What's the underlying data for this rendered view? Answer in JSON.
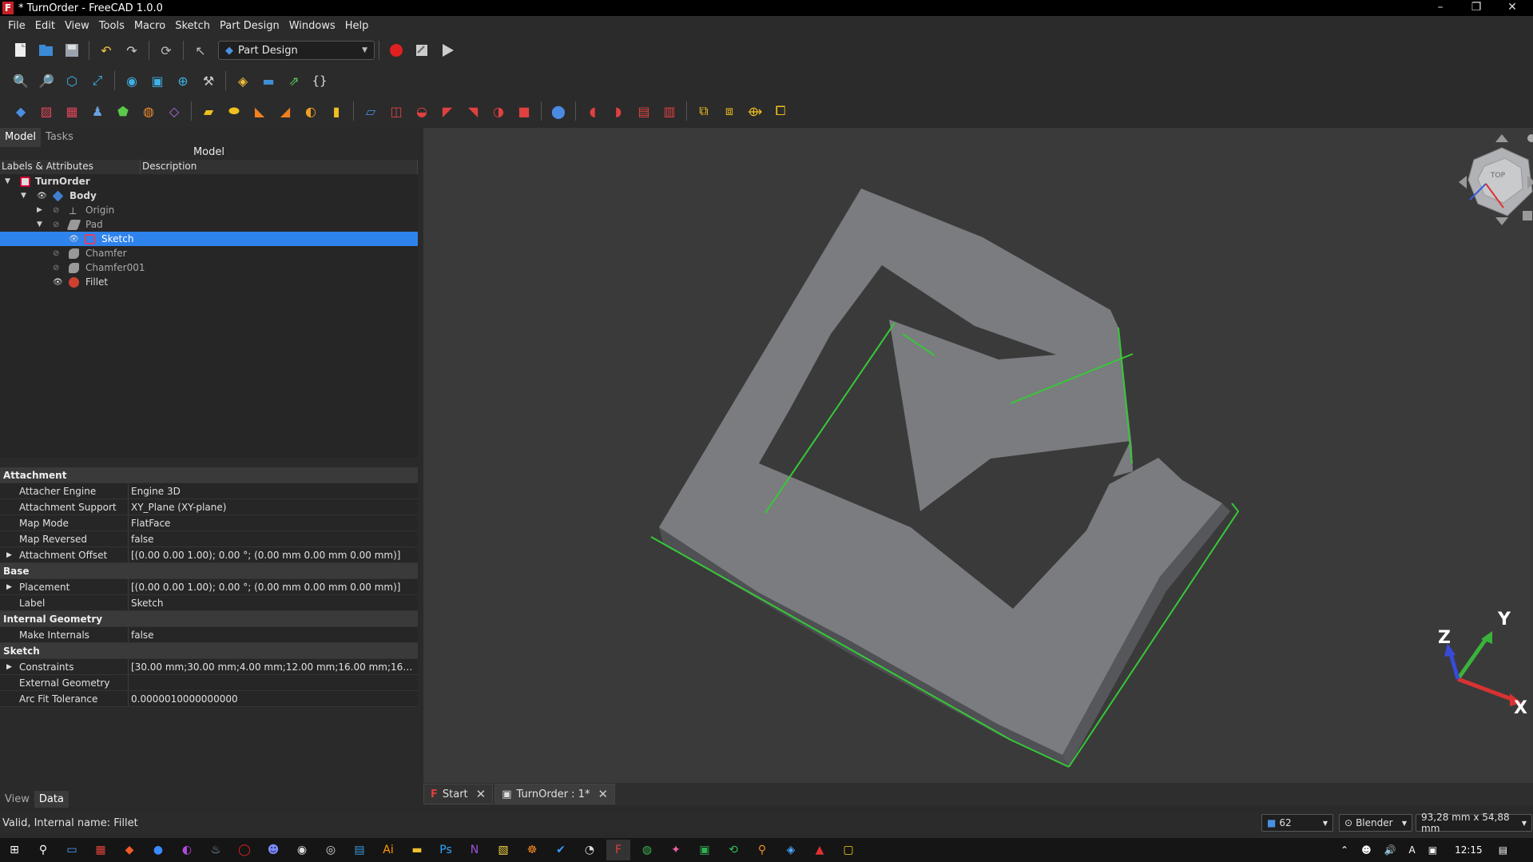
{
  "window": {
    "title": "* TurnOrder - FreeCAD 1.0.0",
    "app_icon": "F"
  },
  "window_controls": {
    "minimize": "–",
    "restore": "❐",
    "close": "✕"
  },
  "menu": [
    "File",
    "Edit",
    "View",
    "Tools",
    "Macro",
    "Sketch",
    "Part Design",
    "Windows",
    "Help"
  ],
  "toolbar": {
    "workbench": "Part Design",
    "macro_braces": "{}"
  },
  "panel": {
    "tabs": [
      "Model",
      "Tasks"
    ],
    "title": "Model",
    "columns": [
      "Labels & Attributes",
      "Description"
    ]
  },
  "tree": [
    {
      "label": "TurnOrder",
      "level": 0,
      "bold": true,
      "icon": "document-icon"
    },
    {
      "label": "Body",
      "level": 1,
      "bold": true,
      "icon": "body-icon"
    },
    {
      "label": "Origin",
      "level": 2,
      "icon": "origin-icon"
    },
    {
      "label": "Pad",
      "level": 2,
      "icon": "pad-icon"
    },
    {
      "label": "Sketch",
      "level": 3,
      "icon": "sketch-icon",
      "selected": true
    },
    {
      "label": "Chamfer",
      "level": 2,
      "icon": "chamfer-icon"
    },
    {
      "label": "Chamfer001",
      "level": 2,
      "icon": "chamfer-icon"
    },
    {
      "label": "Fillet",
      "level": 2,
      "icon": "fillet-icon"
    }
  ],
  "properties": [
    {
      "group": "Attachment"
    },
    {
      "name": "Attacher Engine",
      "value": "Engine 3D"
    },
    {
      "name": "Attachment Support",
      "value": "XY_Plane (XY-plane)"
    },
    {
      "name": "Map Mode",
      "value": "FlatFace"
    },
    {
      "name": "Map Reversed",
      "value": "false"
    },
    {
      "name": "Attachment Offset",
      "value": "[(0.00 0.00 1.00); 0.00 °; (0.00 mm  0.00 mm  0.00 mm)]",
      "expand": true
    },
    {
      "group": "Base"
    },
    {
      "name": "Placement",
      "value": "[(0.00 0.00 1.00); 0.00 °; (0.00 mm  0.00 mm  0.00 mm)]",
      "expand": true
    },
    {
      "name": "Label",
      "value": "Sketch"
    },
    {
      "group": "Internal Geometry"
    },
    {
      "name": "Make Internals",
      "value": "false"
    },
    {
      "group": "Sketch"
    },
    {
      "name": "Constraints",
      "value": "[30.00 mm;30.00 mm;4.00 mm;12.00 mm;16.00 mm;16.00 m...",
      "expand": true
    },
    {
      "name": "External Geometry",
      "value": ""
    },
    {
      "name": "Arc Fit Tolerance",
      "value": "0.0000010000000000"
    }
  ],
  "bottom_tabs": [
    "View",
    "Data"
  ],
  "doc_tabs": [
    {
      "label": "Start"
    },
    {
      "label": "TurnOrder : 1*"
    }
  ],
  "axes": {
    "x": "X",
    "y": "Y",
    "z": "Z"
  },
  "navcube_face": "TOP",
  "status": {
    "message": "Valid, Internal name: Fillet",
    "draw_style": "62",
    "nav_style": "Blender",
    "dimensions": "93,28 mm x 54,88 mm"
  },
  "clock": "12:15",
  "colors": {
    "selection": "#2f83ec",
    "edge_highlight": "#37c837",
    "part": "#6e7075"
  }
}
